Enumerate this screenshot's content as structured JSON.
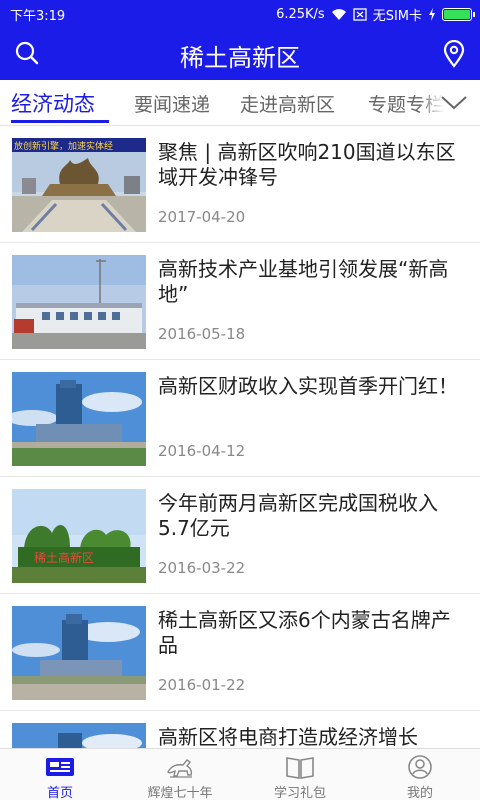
{
  "status_bar": {
    "time": "下午3:19",
    "net_speed": "6.25K/s",
    "sim": "无SIM卡",
    "battery_level": 1.0
  },
  "header": {
    "title": "稀土高新区",
    "search_icon": "search-icon",
    "location_icon": "location-pin-icon"
  },
  "tabs": [
    {
      "label": "经济动态",
      "active": true
    },
    {
      "label": "要闻速递",
      "active": false
    },
    {
      "label": "走进高新区",
      "active": false
    },
    {
      "label": "专题专栏",
      "active": false
    }
  ],
  "tabs_more_icon": "chevron-down-icon",
  "articles": [
    {
      "title": "聚焦 | 高新区吹响210国道以东区域开发冲锋号",
      "date": "2017-04-20",
      "thumb_caption": "放创新引擎，加速实体经"
    },
    {
      "title": "高新技术产业基地引领发展“新高地”",
      "date": "2016-05-18"
    },
    {
      "title": "高新区财政收入实现首季开门红！",
      "date": "2016-04-12"
    },
    {
      "title": "今年前两月高新区完成国税收入5.7亿元",
      "date": "2016-03-22",
      "thumb_caption": "稀土高新区"
    },
    {
      "title": "稀土高新区又添6个内蒙古名牌产品",
      "date": "2016-01-22"
    },
    {
      "title": "高新区将电商打造成经济增长",
      "date": ""
    }
  ],
  "bottom_nav": [
    {
      "label": "首页",
      "icon": "news-icon",
      "active": true
    },
    {
      "label": "辉煌七十年",
      "icon": "horse-icon",
      "active": false
    },
    {
      "label": "学习礼包",
      "icon": "book-icon",
      "active": false
    },
    {
      "label": "我的",
      "icon": "user-icon",
      "active": false
    }
  ],
  "colors": {
    "brand": "#1c1ce8",
    "battery": "#35e05a"
  }
}
